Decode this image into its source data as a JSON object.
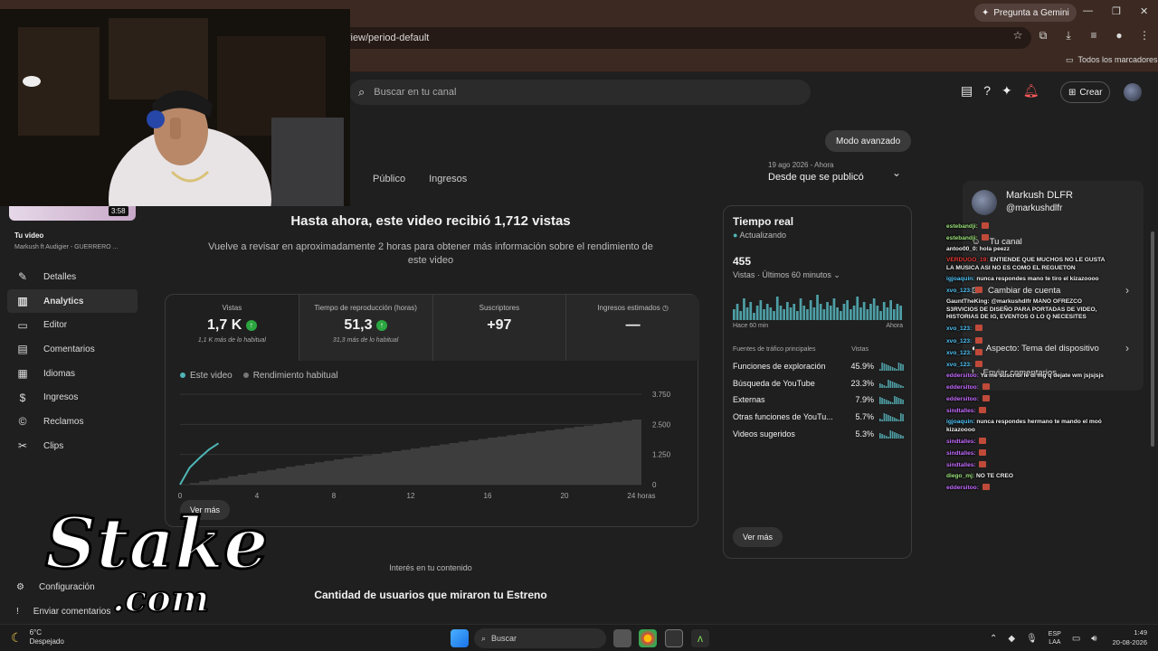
{
  "browser": {
    "gemini_label": "Pregunta a Gemini",
    "url": "view/period-default",
    "bookmarks_all": "Todos los marcadores"
  },
  "header": {
    "search_placeholder": "Buscar en tu canal",
    "create_label": "Crear",
    "advanced_mode": "Modo avanzado"
  },
  "tabs": [
    "Público",
    "Ingresos"
  ],
  "period": {
    "dates": "19 ago 2026 - Ahora",
    "label": "Desde que se publicó"
  },
  "video": {
    "duration": "3:58",
    "title": "Tu video",
    "subtitle": "Markush ft Audigier - GUERRERO ..."
  },
  "sidebar": {
    "items": [
      {
        "label": "Detalles",
        "icon": "pencil-icon"
      },
      {
        "label": "Analytics",
        "icon": "analytics-icon"
      },
      {
        "label": "Editor",
        "icon": "editor-icon"
      },
      {
        "label": "Comentarios",
        "icon": "comments-icon"
      },
      {
        "label": "Idiomas",
        "icon": "subtitles-icon"
      },
      {
        "label": "Ingresos",
        "icon": "money-icon"
      },
      {
        "label": "Reclamos",
        "icon": "claims-icon"
      },
      {
        "label": "Clips",
        "icon": "scissors-icon"
      }
    ],
    "settings_label": "Configuración",
    "feedback_label": "Enviar comentarios"
  },
  "analytics": {
    "headline": "Hasta ahora, este video recibió 1,712 vistas",
    "subline": "Vuelve a revisar en aproximadamente 2 horas para obtener más información sobre el rendimiento de este video",
    "metrics": [
      {
        "label": "Vistas",
        "value": "1,7 K",
        "note": "1,1 K más de lo habitual"
      },
      {
        "label": "Tiempo de reproducción (horas)",
        "value": "51,3",
        "note": "31,3 más de lo habitual"
      },
      {
        "label": "Suscriptores",
        "value": "+97"
      },
      {
        "label": "Ingresos estimados",
        "value": "—"
      }
    ],
    "legend": [
      "Este video",
      "Rendimiento habitual"
    ],
    "see_more": "Ver más"
  },
  "chart_data": {
    "type": "area",
    "x_ticks": [
      "0",
      "4",
      "8",
      "12",
      "16",
      "20",
      "24 horas"
    ],
    "y_ticks": [
      "3.750",
      "2.500",
      "1.250",
      "0"
    ],
    "ylim": [
      0,
      3750
    ],
    "series": [
      {
        "name": "Este video",
        "x": [
          0,
          0.5,
          1,
          1.5,
          2
        ],
        "y": [
          0,
          700,
          1100,
          1450,
          1712
        ]
      },
      {
        "name": "Rendimiento habitual",
        "x": [
          0,
          4,
          8,
          12,
          16,
          20,
          24
        ],
        "y": [
          0,
          550,
          1050,
          1500,
          1950,
          2350,
          2750
        ]
      }
    ],
    "colors": {
      "video": "#4fb6b6",
      "habitual": "#3d3d3d"
    }
  },
  "realtime": {
    "title": "Tiempo real",
    "status": "Actualizando",
    "count": "455",
    "period": "Vistas · Últimos 60 minutos",
    "axis_start": "Hace 60 min",
    "axis_end": "Ahora",
    "spark": [
      6,
      9,
      5,
      12,
      7,
      10,
      4,
      8,
      11,
      6,
      9,
      7,
      5,
      13,
      8,
      6,
      10,
      7,
      9,
      5,
      12,
      8,
      6,
      11,
      7,
      14,
      9,
      6,
      10,
      8,
      12,
      7,
      5,
      9,
      11,
      6,
      8,
      13,
      7,
      10,
      6,
      9,
      12,
      8,
      5,
      10,
      7,
      11,
      6,
      9,
      8
    ],
    "table_header": "Fuentes de tráfico principales",
    "table_col": "Vistas",
    "rows": [
      {
        "name": "Funciones de exploración",
        "pct": "45.9%"
      },
      {
        "name": "Búsqueda de YouTube",
        "pct": "23.3%"
      },
      {
        "name": "Externas",
        "pct": "7.9%"
      },
      {
        "name": "Otras funciones de YouTu...",
        "pct": "5.7%"
      },
      {
        "name": "Videos sugeridos",
        "pct": "5.3%"
      }
    ],
    "see_more": "Ver más"
  },
  "bottom": {
    "section": "Interés en tu contenido",
    "title": "Cantidad de usuarios que miraron tu Estreno"
  },
  "account": {
    "name": "Markush DLFR",
    "handle": "@markushdlfr",
    "items": [
      "Tu canal",
      "Cambiar de cuenta",
      "Aspecto: Tema del dispositivo",
      "Enviar comentarios"
    ]
  },
  "chat": [
    {
      "user": "estebandji:",
      "text": "",
      "cls": "u4",
      "emo": true
    },
    {
      "user": "estebandji:",
      "text": "",
      "cls": "u4",
      "emo": true
    },
    {
      "user": "antoo00_0:",
      "text": "hola peezz",
      "cls": ""
    },
    {
      "user": "VERDUGO_19:",
      "text": "ENTIENDE QUE MUCHOS NO LE GUSTA LA MUSICA ASI NO ES COMO EL REGUETON",
      "cls": "u3"
    },
    {
      "user": "igjoaquin:",
      "text": "nunca respondes mano te tiro el kizazoooo",
      "cls": "u"
    },
    {
      "user": "xvo_123:",
      "text": "",
      "cls": "u",
      "emo": true
    },
    {
      "user": "GauntTheKing:",
      "text": "@markushdlfr MANO OFREZCO S3RVICIOS DE DISEÑO PARA PORTADAS DE VIDEO, HISTORIAS DE IG, EVENTOS O LO Q NECESITES",
      "cls": ""
    },
    {
      "user": "xvo_123:",
      "text": "",
      "cls": "u",
      "emo": true
    },
    {
      "user": "xvo_123:",
      "text": "",
      "cls": "u",
      "emo": true
    },
    {
      "user": "xvo_123:",
      "text": "",
      "cls": "u",
      "emo": true
    },
    {
      "user": "xvo_123:",
      "text": "",
      "cls": "u",
      "emo": true
    },
    {
      "user": "eddersitoo:",
      "text": "Ya me suscribi le di mg q dejate wm jsjsjsjs",
      "cls": "u2"
    },
    {
      "user": "eddersitoo:",
      "text": "",
      "cls": "u2",
      "emo": true
    },
    {
      "user": "eddersitoo:",
      "text": "",
      "cls": "u2",
      "emo": true
    },
    {
      "user": "sindtalles:",
      "text": "",
      "cls": "u2",
      "emo": true
    },
    {
      "user": "igjoaquin:",
      "text": "nunca respondes hermano te mando el moó kizazoooo",
      "cls": "u"
    },
    {
      "user": "sindtalles:",
      "text": "",
      "cls": "u2",
      "emo": true
    },
    {
      "user": "sindtalles:",
      "text": "",
      "cls": "u2",
      "emo": true
    },
    {
      "user": "sindtalles:",
      "text": "",
      "cls": "u2",
      "emo": true
    },
    {
      "user": "diego_mj:",
      "text": "NO TE CREO",
      "cls": "u4"
    },
    {
      "user": "eddersitoo:",
      "text": "",
      "cls": "u2",
      "emo": true
    }
  ],
  "overlay_logo": {
    "line1": "Stake",
    "line2": ".com"
  },
  "taskbar": {
    "temp": "6°C",
    "weather": "Despejado",
    "search": "Buscar",
    "lang1": "ESP",
    "lang2": "LAA",
    "time": "1:49",
    "date": "20-08-2026"
  }
}
